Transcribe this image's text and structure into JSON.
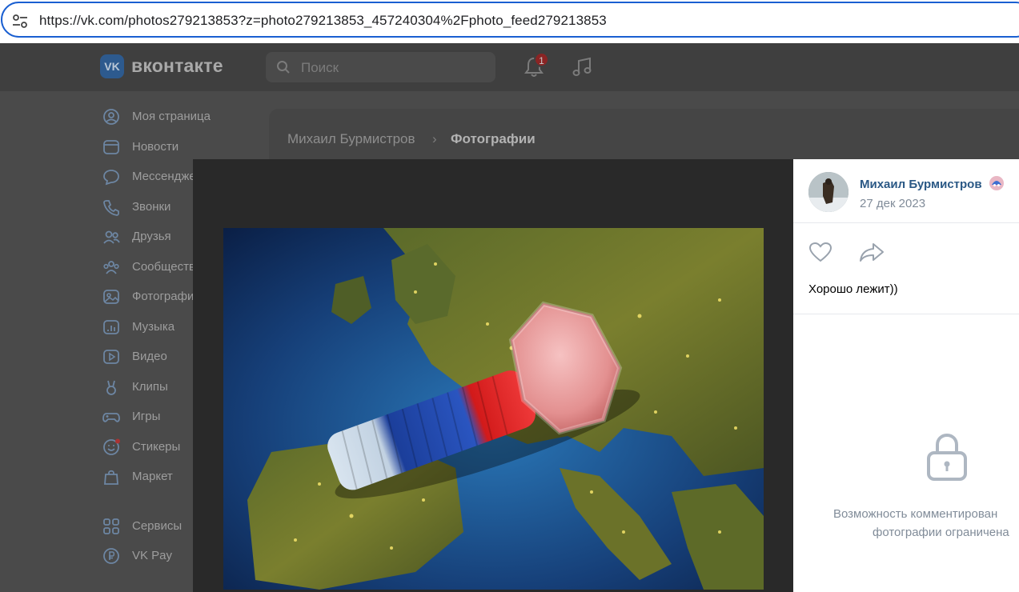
{
  "browser": {
    "url": "https://vk.com/photos279213853?z=photo279213853_457240304%2Fphoto_feed279213853"
  },
  "header": {
    "logo_text": "VK",
    "brand": "вконтакте",
    "search_placeholder": "Поиск",
    "notifications_count": "1"
  },
  "menu": {
    "items": [
      {
        "label": "Моя страница",
        "icon": "user-circle-icon"
      },
      {
        "label": "Новости",
        "icon": "newsfeed-icon"
      },
      {
        "label": "Мессенджер",
        "icon": "chat-bubble-icon"
      },
      {
        "label": "Звонки",
        "icon": "phone-icon"
      },
      {
        "label": "Друзья",
        "icon": "friends-icon"
      },
      {
        "label": "Сообщества",
        "icon": "communities-icon"
      },
      {
        "label": "Фотографии",
        "icon": "image-icon"
      },
      {
        "label": "Музыка",
        "icon": "music-bars-icon"
      },
      {
        "label": "Видео",
        "icon": "video-icon"
      },
      {
        "label": "Клипы",
        "icon": "clips-icon"
      },
      {
        "label": "Игры",
        "icon": "gamepad-icon"
      },
      {
        "label": "Стикеры",
        "icon": "sticker-icon"
      },
      {
        "label": "Маркет",
        "icon": "bag-icon"
      },
      {
        "label": "Сервисы",
        "icon": "grid-icon"
      },
      {
        "label": "VK Pay",
        "icon": "ruble-icon"
      }
    ]
  },
  "breadcrumb": {
    "owner": "Михаил Бурмистров",
    "separator": "›",
    "section": "Фотографии"
  },
  "post": {
    "author": "Михаил Бурмистров",
    "date": "27 дек 2023",
    "caption": "Хорошо лежит))",
    "comments_restricted_line1": "Возможность комментирован",
    "comments_restricted_line2": "фотографии ограничена"
  },
  "colors": {
    "accent_link": "#2a5885",
    "url_border": "#1a5fd1",
    "badge": "#e64646"
  }
}
